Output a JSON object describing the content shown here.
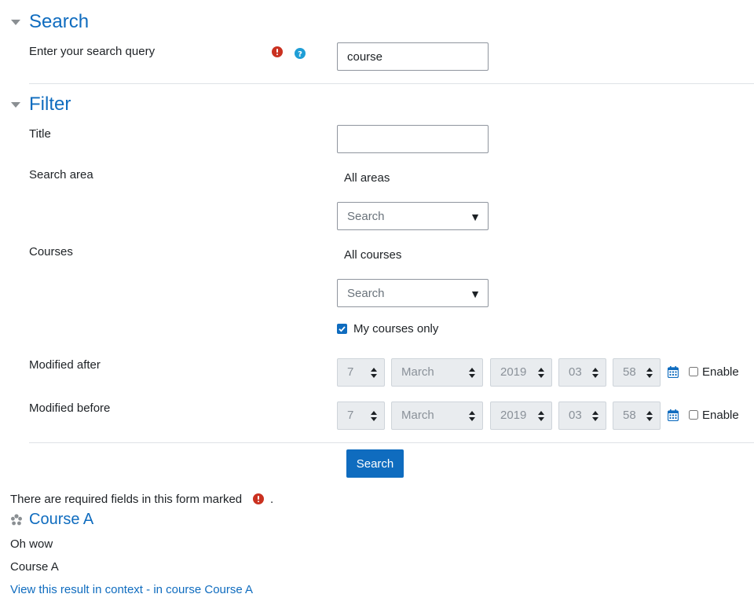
{
  "search_section": {
    "title": "Search",
    "query_label": "Enter your search query",
    "query_value": "course",
    "required_icon": "exclamation-circle-icon",
    "help_icon": "question-circle-icon"
  },
  "filter_section": {
    "title": "Filter",
    "title_label": "Title",
    "title_value": "",
    "search_area_label": "Search area",
    "search_area_value": "All areas",
    "search_area_placeholder": "Search",
    "courses_label": "Courses",
    "courses_value": "All courses",
    "courses_placeholder": "Search",
    "my_courses_only_label": "My courses only",
    "my_courses_only_checked": true,
    "modified_after": {
      "label": "Modified after",
      "day": "7",
      "month": "March",
      "year": "2019",
      "hour": "03",
      "minute": "58",
      "enable_label": "Enable",
      "enabled": false
    },
    "modified_before": {
      "label": "Modified before",
      "day": "7",
      "month": "March",
      "year": "2019",
      "hour": "03",
      "minute": "58",
      "enable_label": "Enable",
      "enabled": false
    }
  },
  "submit_label": "Search",
  "required_note": {
    "text": "There are required fields in this form marked",
    "suffix": "."
  },
  "result": {
    "icon": "course-icon",
    "title": "Course A",
    "content": "Oh wow",
    "course_name": "Course A",
    "context_link": "View this result in context",
    "separator": "-",
    "course_link": "in course Course A"
  },
  "colors": {
    "accent": "#0f6cbf",
    "required": "#ca3120",
    "help": "#1f9ed6"
  }
}
